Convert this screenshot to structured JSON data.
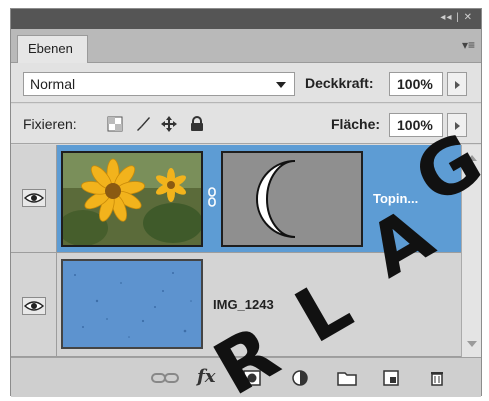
{
  "panel": {
    "tab_label": "Ebenen",
    "menu_glyph": "▾≡",
    "title_controls": "◂◂ | ✕"
  },
  "blend": {
    "mode": "Normal",
    "opacity_label": "Deckkraft:",
    "opacity_value": "100%"
  },
  "lock": {
    "label": "Fixieren:",
    "fill_label": "Fläche:",
    "fill_value": "100%"
  },
  "layers": [
    {
      "name": "Topin...",
      "selected": true,
      "has_mask": true,
      "visible": true
    },
    {
      "name": "IMG_1243",
      "selected": false,
      "has_mask": false,
      "visible": true
    }
  ],
  "bottom_icons": [
    "link-icon",
    "fx-icon",
    "mask-icon",
    "adjustment-icon",
    "folder-icon",
    "new-layer-icon",
    "trash-icon"
  ],
  "fx_label": "fx",
  "watermark_letters": [
    "R",
    "L",
    "A",
    "G"
  ],
  "colors": {
    "selection": "#5d9cd4",
    "panel_bg": "#d9d9d9"
  }
}
